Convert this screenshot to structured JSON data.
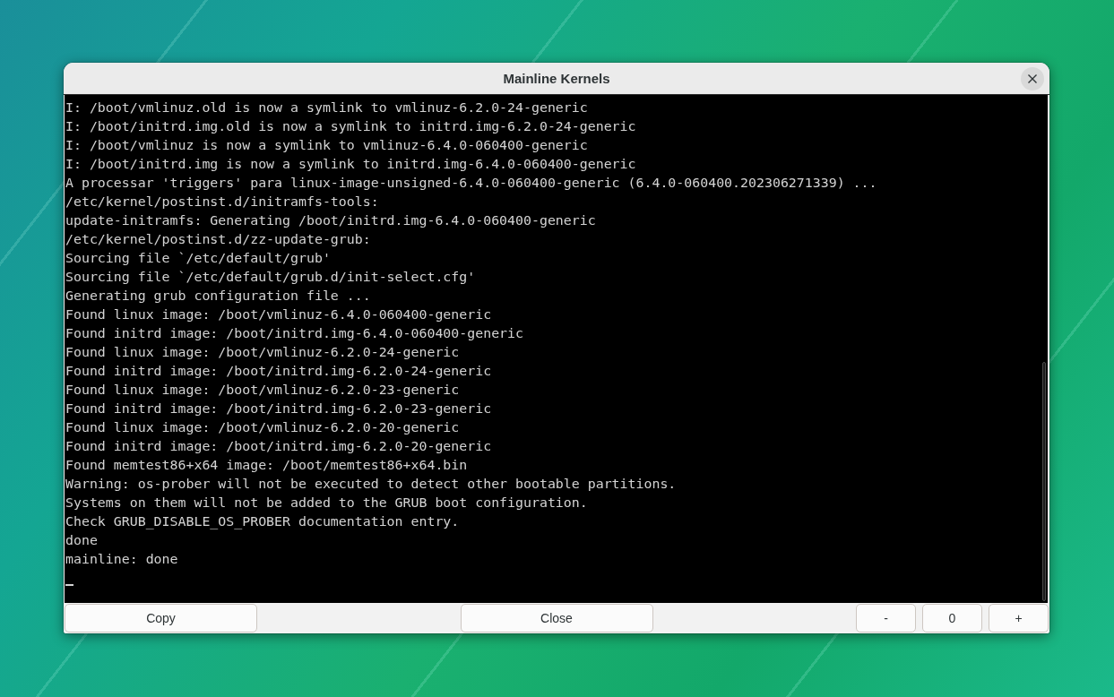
{
  "window": {
    "title": "Mainline Kernels"
  },
  "terminal": {
    "lines": [
      "I: /boot/vmlinuz.old is now a symlink to vmlinuz-6.2.0-24-generic",
      "I: /boot/initrd.img.old is now a symlink to initrd.img-6.2.0-24-generic",
      "I: /boot/vmlinuz is now a symlink to vmlinuz-6.4.0-060400-generic",
      "I: /boot/initrd.img is now a symlink to initrd.img-6.4.0-060400-generic",
      "A processar 'triggers' para linux-image-unsigned-6.4.0-060400-generic (6.4.0-060400.202306271339) ...",
      "/etc/kernel/postinst.d/initramfs-tools:",
      "update-initramfs: Generating /boot/initrd.img-6.4.0-060400-generic",
      "/etc/kernel/postinst.d/zz-update-grub:",
      "Sourcing file `/etc/default/grub'",
      "Sourcing file `/etc/default/grub.d/init-select.cfg'",
      "Generating grub configuration file ...",
      "Found linux image: /boot/vmlinuz-6.4.0-060400-generic",
      "Found initrd image: /boot/initrd.img-6.4.0-060400-generic",
      "Found linux image: /boot/vmlinuz-6.2.0-24-generic",
      "Found initrd image: /boot/initrd.img-6.2.0-24-generic",
      "Found linux image: /boot/vmlinuz-6.2.0-23-generic",
      "Found initrd image: /boot/initrd.img-6.2.0-23-generic",
      "Found linux image: /boot/vmlinuz-6.2.0-20-generic",
      "Found initrd image: /boot/initrd.img-6.2.0-20-generic",
      "Found memtest86+x64 image: /boot/memtest86+x64.bin",
      "Warning: os-prober will not be executed to detect other bootable partitions.",
      "Systems on them will not be added to the GRUB boot configuration.",
      "Check GRUB_DISABLE_OS_PROBER documentation entry.",
      "done",
      "mainline: done"
    ],
    "cursor": true
  },
  "buttons": {
    "copy": "Copy",
    "close": "Close"
  },
  "font_size": {
    "decrease": "-",
    "value": "0",
    "increase": "+"
  }
}
